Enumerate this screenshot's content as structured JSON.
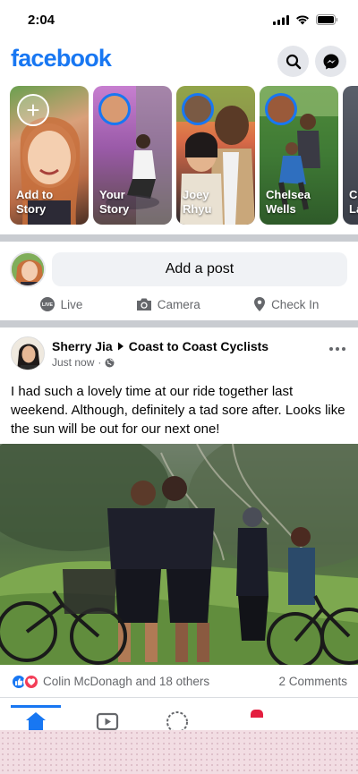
{
  "status_bar": {
    "time": "2:04"
  },
  "header": {
    "logo": "facebook",
    "search_icon": "search-icon",
    "messenger_icon": "messenger-icon"
  },
  "stories": [
    {
      "label": "Add to\nStory",
      "type": "create"
    },
    {
      "label": "Your\nStory",
      "type": "story"
    },
    {
      "label": "Joey\nRhyu",
      "type": "story"
    },
    {
      "label": "Chelsea\nWells",
      "type": "story"
    },
    {
      "label": "Ch\nLa",
      "type": "story"
    }
  ],
  "composer": {
    "placeholder": "Add a post",
    "actions": [
      {
        "label": "Live",
        "icon": "live-icon"
      },
      {
        "label": "Camera",
        "icon": "camera-icon"
      },
      {
        "label": "Check In",
        "icon": "location-pin-icon"
      }
    ]
  },
  "post": {
    "author": "Sherry Jia",
    "group": "Coast to Coast Cyclists",
    "time": "Just now",
    "audience_icon": "globe-icon",
    "text": "I had such a lovely time at our ride together last weekend. Although, definitely a tad sore after. Looks like the sun will be out for our next one!",
    "reactions_text": "Colin McDonagh and 18 others",
    "comments_text": "2 Comments"
  },
  "tabbar": {
    "items": [
      "home-icon",
      "watch-icon",
      "profile-icon",
      "notifications-icon"
    ]
  },
  "colors": {
    "brand": "#1877f2",
    "secondary_text": "#65676b",
    "love": "#f33e58",
    "badge": "#e41e3f"
  }
}
